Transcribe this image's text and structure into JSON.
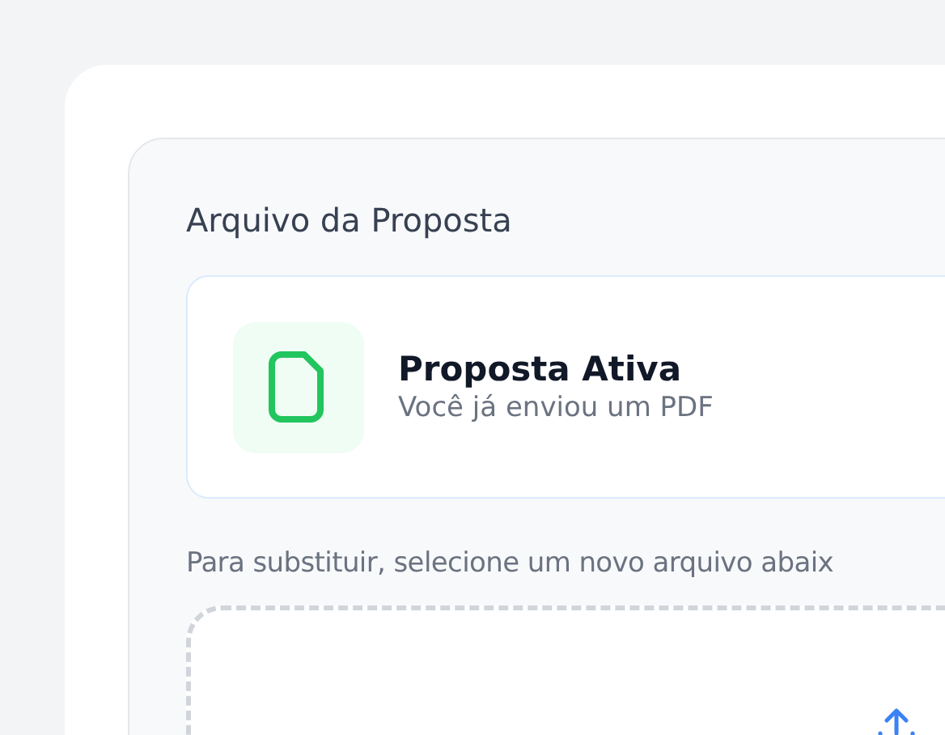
{
  "section": {
    "title": "Arquivo da Proposta"
  },
  "active_file": {
    "title": "Proposta Ativa",
    "subtitle": "Você já enviou um PDF"
  },
  "replace_hint": "Para substituir, selecione um novo arquivo abaix"
}
